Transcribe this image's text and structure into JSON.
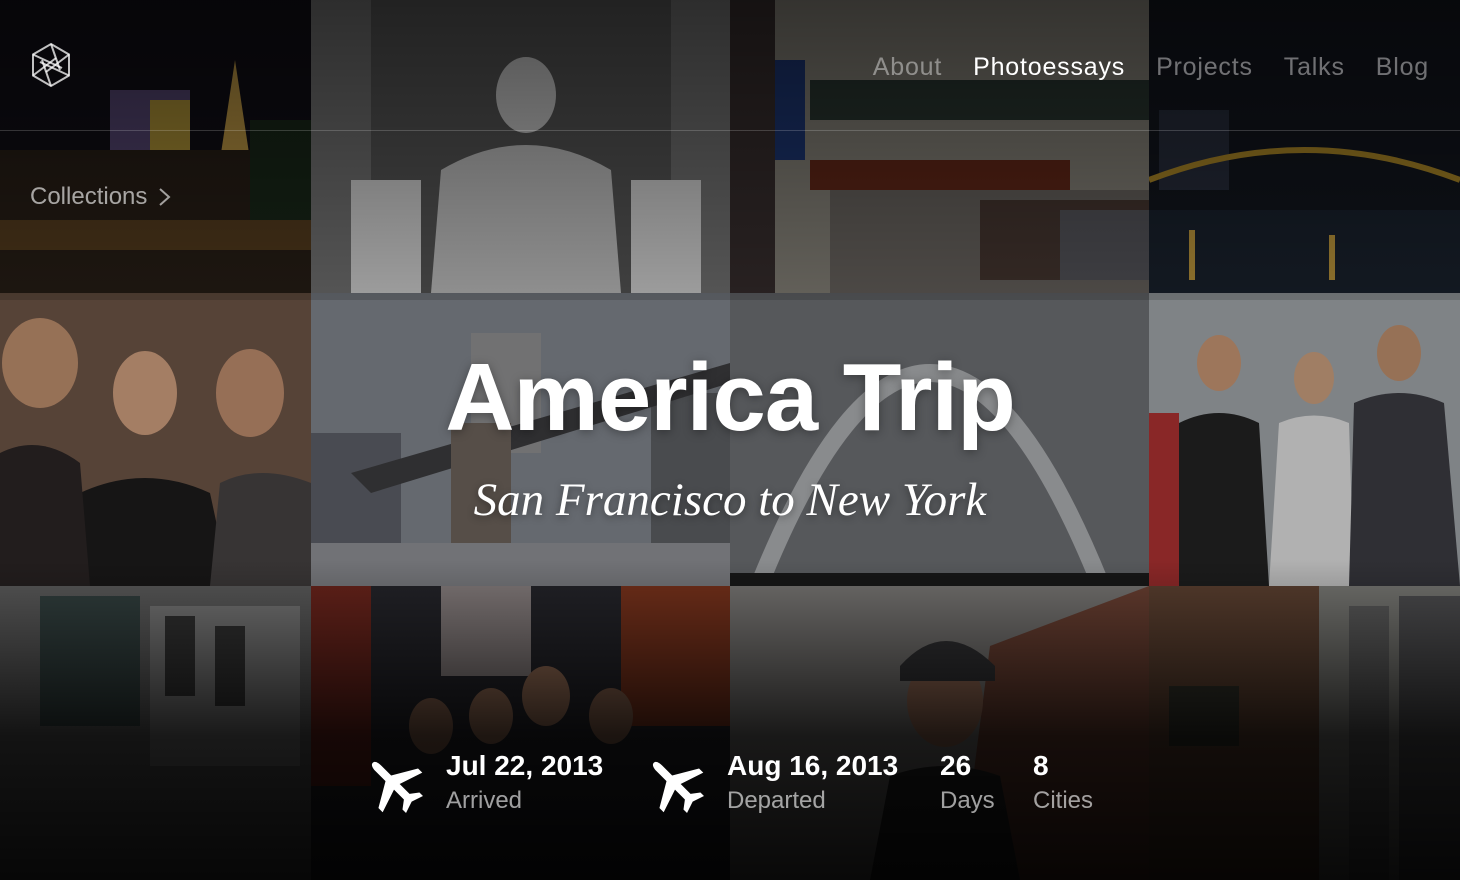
{
  "header": {
    "logo_icon": "aperture-icon",
    "nav": [
      {
        "label": "About",
        "active": false
      },
      {
        "label": "Photoessays",
        "active": true
      },
      {
        "label": "Projects",
        "active": false
      },
      {
        "label": "Talks",
        "active": false
      },
      {
        "label": "Blog",
        "active": false
      }
    ]
  },
  "collections": {
    "label": "Collections",
    "icon": "chevron-right-icon"
  },
  "hero": {
    "title": "America Trip",
    "subtitle": "San Francisco to New York"
  },
  "stats": [
    {
      "value": "Jul 22, 2013",
      "label": "Arrived",
      "icon": "airplane-icon"
    },
    {
      "value": "Aug 16, 2013",
      "label": "Departed",
      "icon": "airplane-icon"
    },
    {
      "value": "26",
      "label": "Days"
    },
    {
      "value": "8",
      "label": "Cities"
    }
  ],
  "colors": {
    "active_nav": "#ffffff",
    "inactive_nav": "#8a8a8a",
    "background": "#0b0b0c"
  }
}
